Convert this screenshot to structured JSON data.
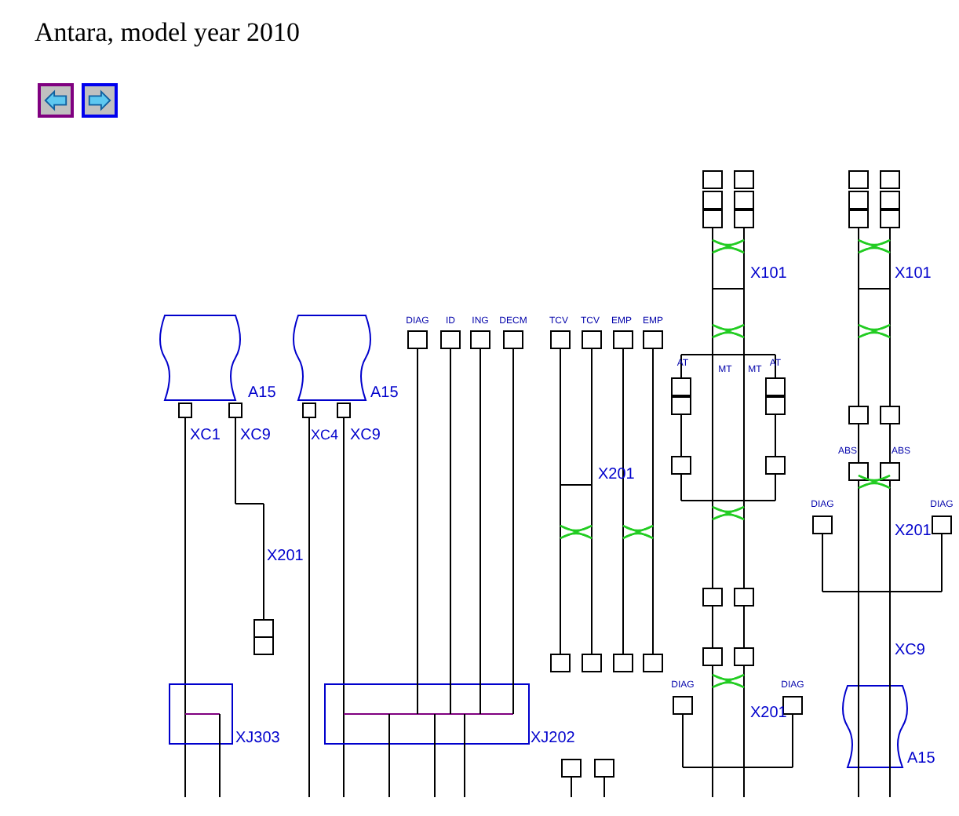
{
  "page": {
    "title": "Antara, model year 2010"
  },
  "nav_buttons": [
    {
      "kind": "back",
      "visited": true
    },
    {
      "kind": "forward",
      "visited": false
    }
  ],
  "diagram": {
    "labels": [
      {
        "kind": "module",
        "text": "A15"
      },
      {
        "kind": "module",
        "text": "A15"
      },
      {
        "kind": "module",
        "text": "A15"
      },
      {
        "kind": "connector",
        "text": "XC1"
      },
      {
        "kind": "connector",
        "text": "XC9"
      },
      {
        "kind": "connector",
        "text": "XC4"
      },
      {
        "kind": "connector",
        "text": "XC9"
      },
      {
        "kind": "connector",
        "text": "X201"
      },
      {
        "kind": "connector",
        "text": "XJ303"
      },
      {
        "kind": "connector",
        "text": "XJ202"
      },
      {
        "kind": "connector",
        "text": "X201"
      },
      {
        "kind": "connector",
        "text": "X101"
      },
      {
        "kind": "connector",
        "text": "X101"
      },
      {
        "kind": "connector",
        "text": "X201"
      },
      {
        "kind": "connector",
        "text": "X201"
      },
      {
        "kind": "connector",
        "text": "XC9"
      },
      {
        "kind": "signal",
        "text": "DIAG"
      },
      {
        "kind": "signal",
        "text": "ID"
      },
      {
        "kind": "signal",
        "text": "ING"
      },
      {
        "kind": "signal",
        "text": "DECM"
      },
      {
        "kind": "signal",
        "text": "TCV"
      },
      {
        "kind": "signal",
        "text": "TCV"
      },
      {
        "kind": "signal",
        "text": "EMP"
      },
      {
        "kind": "signal",
        "text": "EMP"
      },
      {
        "kind": "signal",
        "text": "AT"
      },
      {
        "kind": "signal",
        "text": "MT"
      },
      {
        "kind": "signal",
        "text": "MT"
      },
      {
        "kind": "signal",
        "text": "AT"
      },
      {
        "kind": "signal",
        "text": "ABS"
      },
      {
        "kind": "signal",
        "text": "ABS"
      },
      {
        "kind": "signal",
        "text": "DIAG"
      },
      {
        "kind": "signal",
        "text": "DIAG"
      },
      {
        "kind": "signal",
        "text": "DIAG"
      },
      {
        "kind": "signal",
        "text": "DIAG"
      }
    ]
  }
}
